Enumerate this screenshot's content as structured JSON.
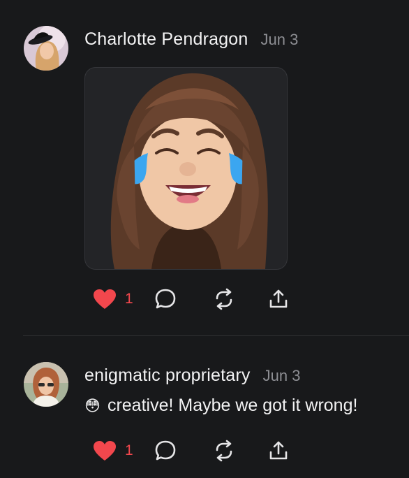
{
  "posts": [
    {
      "author": "Charlotte Pendragon",
      "date": "Jun 3",
      "like_count": "1"
    },
    {
      "author": "enigmatic proprietary",
      "date": "Jun 3",
      "emoji": "😳",
      "text": "creative! Maybe we got it wrong!",
      "like_count": "1"
    }
  ],
  "icons": {
    "like": "heart-icon",
    "reply": "comment-bubble-icon",
    "repost": "repost-icon",
    "share": "share-icon"
  },
  "colors": {
    "background": "#18191b",
    "like_active": "#f2474d",
    "muted": "#8d8e93"
  }
}
